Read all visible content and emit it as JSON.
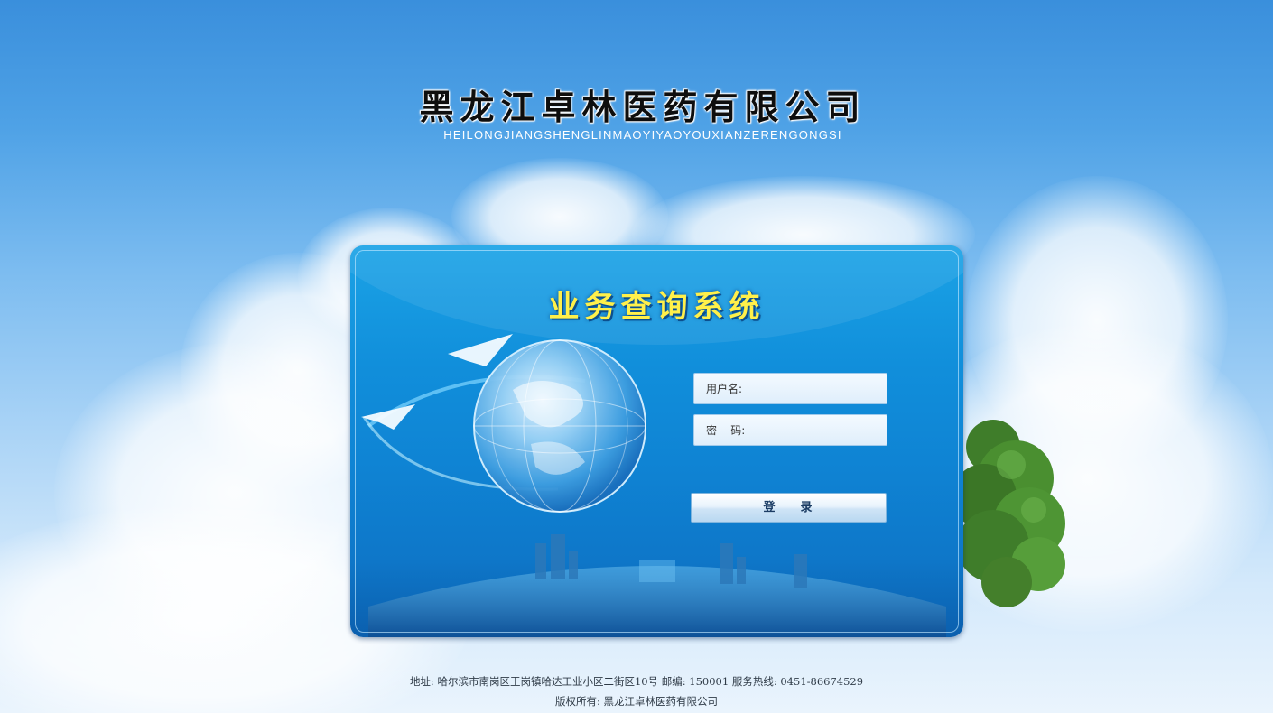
{
  "header": {
    "company_name_cn": "黑龙江卓林医药有限公司",
    "company_name_en": "HEILONGJIANGSHENGLINMAOYIYAOYOUXIANZERENGONGSI"
  },
  "login_panel": {
    "system_title": "业务查询系统",
    "username_label": "用户名:",
    "password_label": "密    码:",
    "login_button_label": "登    录"
  },
  "footer": {
    "address_line": "地址: 哈尔滨市南岗区王岗镇哈达工业小区二街区10号 邮编: 150001 服务热线: 0451-86674529",
    "copyright_line": "版权所有: 黑龙江卓林医药有限公司"
  },
  "colors": {
    "sky_top": "#3a8fdc",
    "panel_blue": "#118fdb",
    "title_yellow": "#fff04a"
  }
}
